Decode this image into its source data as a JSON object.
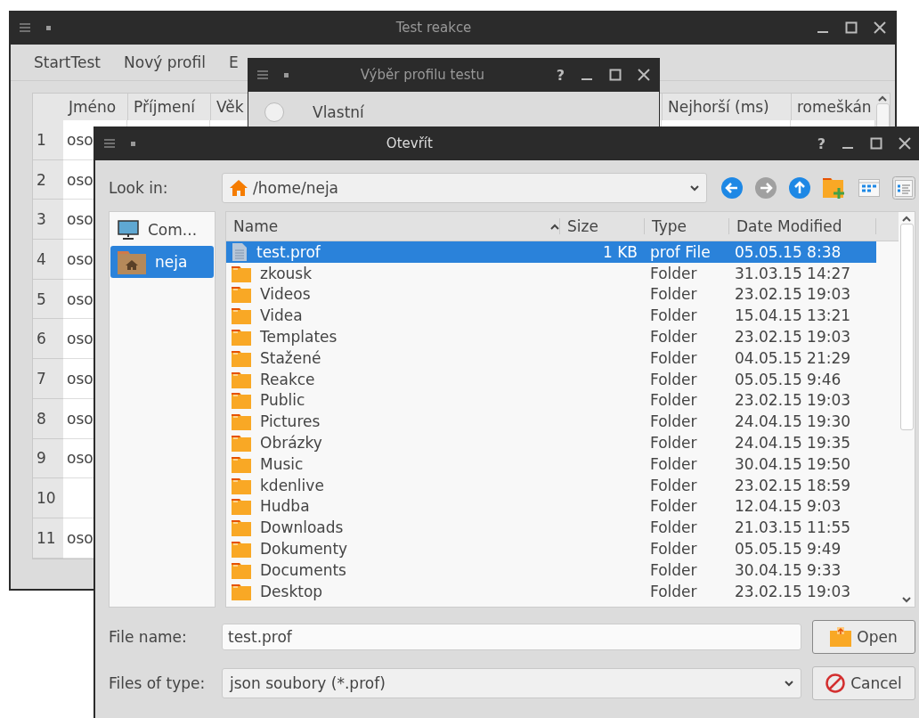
{
  "main_window": {
    "title": "Test reakce",
    "menu": [
      "StartTest",
      "Nový profil",
      "E"
    ],
    "table": {
      "columns": [
        "Jméno",
        "Příjmení",
        "Věk",
        "Nejhorší (ms)",
        "romeškán"
      ],
      "rows": [
        {
          "number": "1",
          "name": "oso"
        },
        {
          "number": "2",
          "name": "oso"
        },
        {
          "number": "3",
          "name": "oso"
        },
        {
          "number": "4",
          "name": "oso"
        },
        {
          "number": "5",
          "name": "oso"
        },
        {
          "number": "6",
          "name": "oso"
        },
        {
          "number": "7",
          "name": "oso"
        },
        {
          "number": "8",
          "name": "oso"
        },
        {
          "number": "9",
          "name": "oso"
        },
        {
          "number": "10"
        },
        {
          "number": "11",
          "name": "oso"
        }
      ]
    }
  },
  "profile_dialog": {
    "title": "Výběr profilu testu",
    "help": "?",
    "options": [
      {
        "label": "Vlastní",
        "selected": false
      }
    ]
  },
  "open_dialog": {
    "title": "Otevřít",
    "help": "?",
    "look_in_label": "Look in:",
    "look_in_path": "/home/neja",
    "places": [
      {
        "label": "Com...",
        "kind": "computer",
        "selected": false
      },
      {
        "label": "neja",
        "kind": "home",
        "selected": true
      }
    ],
    "columns": [
      {
        "label": "Name",
        "sorted": true
      },
      {
        "label": "Size",
        "sorted": false
      },
      {
        "label": "Type",
        "sorted": false
      },
      {
        "label": "Date Modified",
        "sorted": false
      }
    ],
    "files": [
      {
        "name": "test.prof",
        "kind": "file",
        "size": "1 KB",
        "type": "prof File",
        "modified": "05.05.15 8:38",
        "selected": true
      },
      {
        "name": "zkousk",
        "kind": "folder",
        "type": "Folder",
        "modified": "31.03.15 14:27",
        "selected": false
      },
      {
        "name": "Videos",
        "kind": "folder",
        "type": "Folder",
        "modified": "23.02.15 19:03",
        "selected": false
      },
      {
        "name": "Videa",
        "kind": "folder",
        "type": "Folder",
        "modified": "15.04.15 13:21",
        "selected": false
      },
      {
        "name": "Templates",
        "kind": "folder",
        "type": "Folder",
        "modified": "23.02.15 19:03",
        "selected": false
      },
      {
        "name": "Stažené",
        "kind": "folder",
        "type": "Folder",
        "modified": "04.05.15 21:29",
        "selected": false
      },
      {
        "name": "Reakce",
        "kind": "folder",
        "type": "Folder",
        "modified": "05.05.15 9:46",
        "selected": false
      },
      {
        "name": "Public",
        "kind": "folder",
        "type": "Folder",
        "modified": "23.02.15 19:03",
        "selected": false
      },
      {
        "name": "Pictures",
        "kind": "folder",
        "type": "Folder",
        "modified": "24.04.15 19:30",
        "selected": false
      },
      {
        "name": "Obrázky",
        "kind": "folder",
        "type": "Folder",
        "modified": "24.04.15 19:35",
        "selected": false
      },
      {
        "name": "Music",
        "kind": "folder",
        "type": "Folder",
        "modified": "30.04.15 19:50",
        "selected": false
      },
      {
        "name": "kdenlive",
        "kind": "folder",
        "type": "Folder",
        "modified": "23.02.15 18:59",
        "selected": false
      },
      {
        "name": "Hudba",
        "kind": "folder",
        "type": "Folder",
        "modified": "12.04.15 9:03",
        "selected": false
      },
      {
        "name": "Downloads",
        "kind": "folder",
        "type": "Folder",
        "modified": "21.03.15 11:55",
        "selected": false
      },
      {
        "name": "Dokumenty",
        "kind": "folder",
        "type": "Folder",
        "modified": "05.05.15 9:49",
        "selected": false
      },
      {
        "name": "Documents",
        "kind": "folder",
        "type": "Folder",
        "modified": "30.04.15 9:33",
        "selected": false
      },
      {
        "name": "Desktop",
        "kind": "folder",
        "type": "Folder",
        "modified": "23.02.15 19:03",
        "selected": false
      }
    ],
    "file_name_label": "File name:",
    "file_name": "test.prof",
    "type_label": "Files of type:",
    "file_type": "json soubory (*.prof)",
    "open_button": "Open",
    "cancel_button": "Cancel"
  }
}
